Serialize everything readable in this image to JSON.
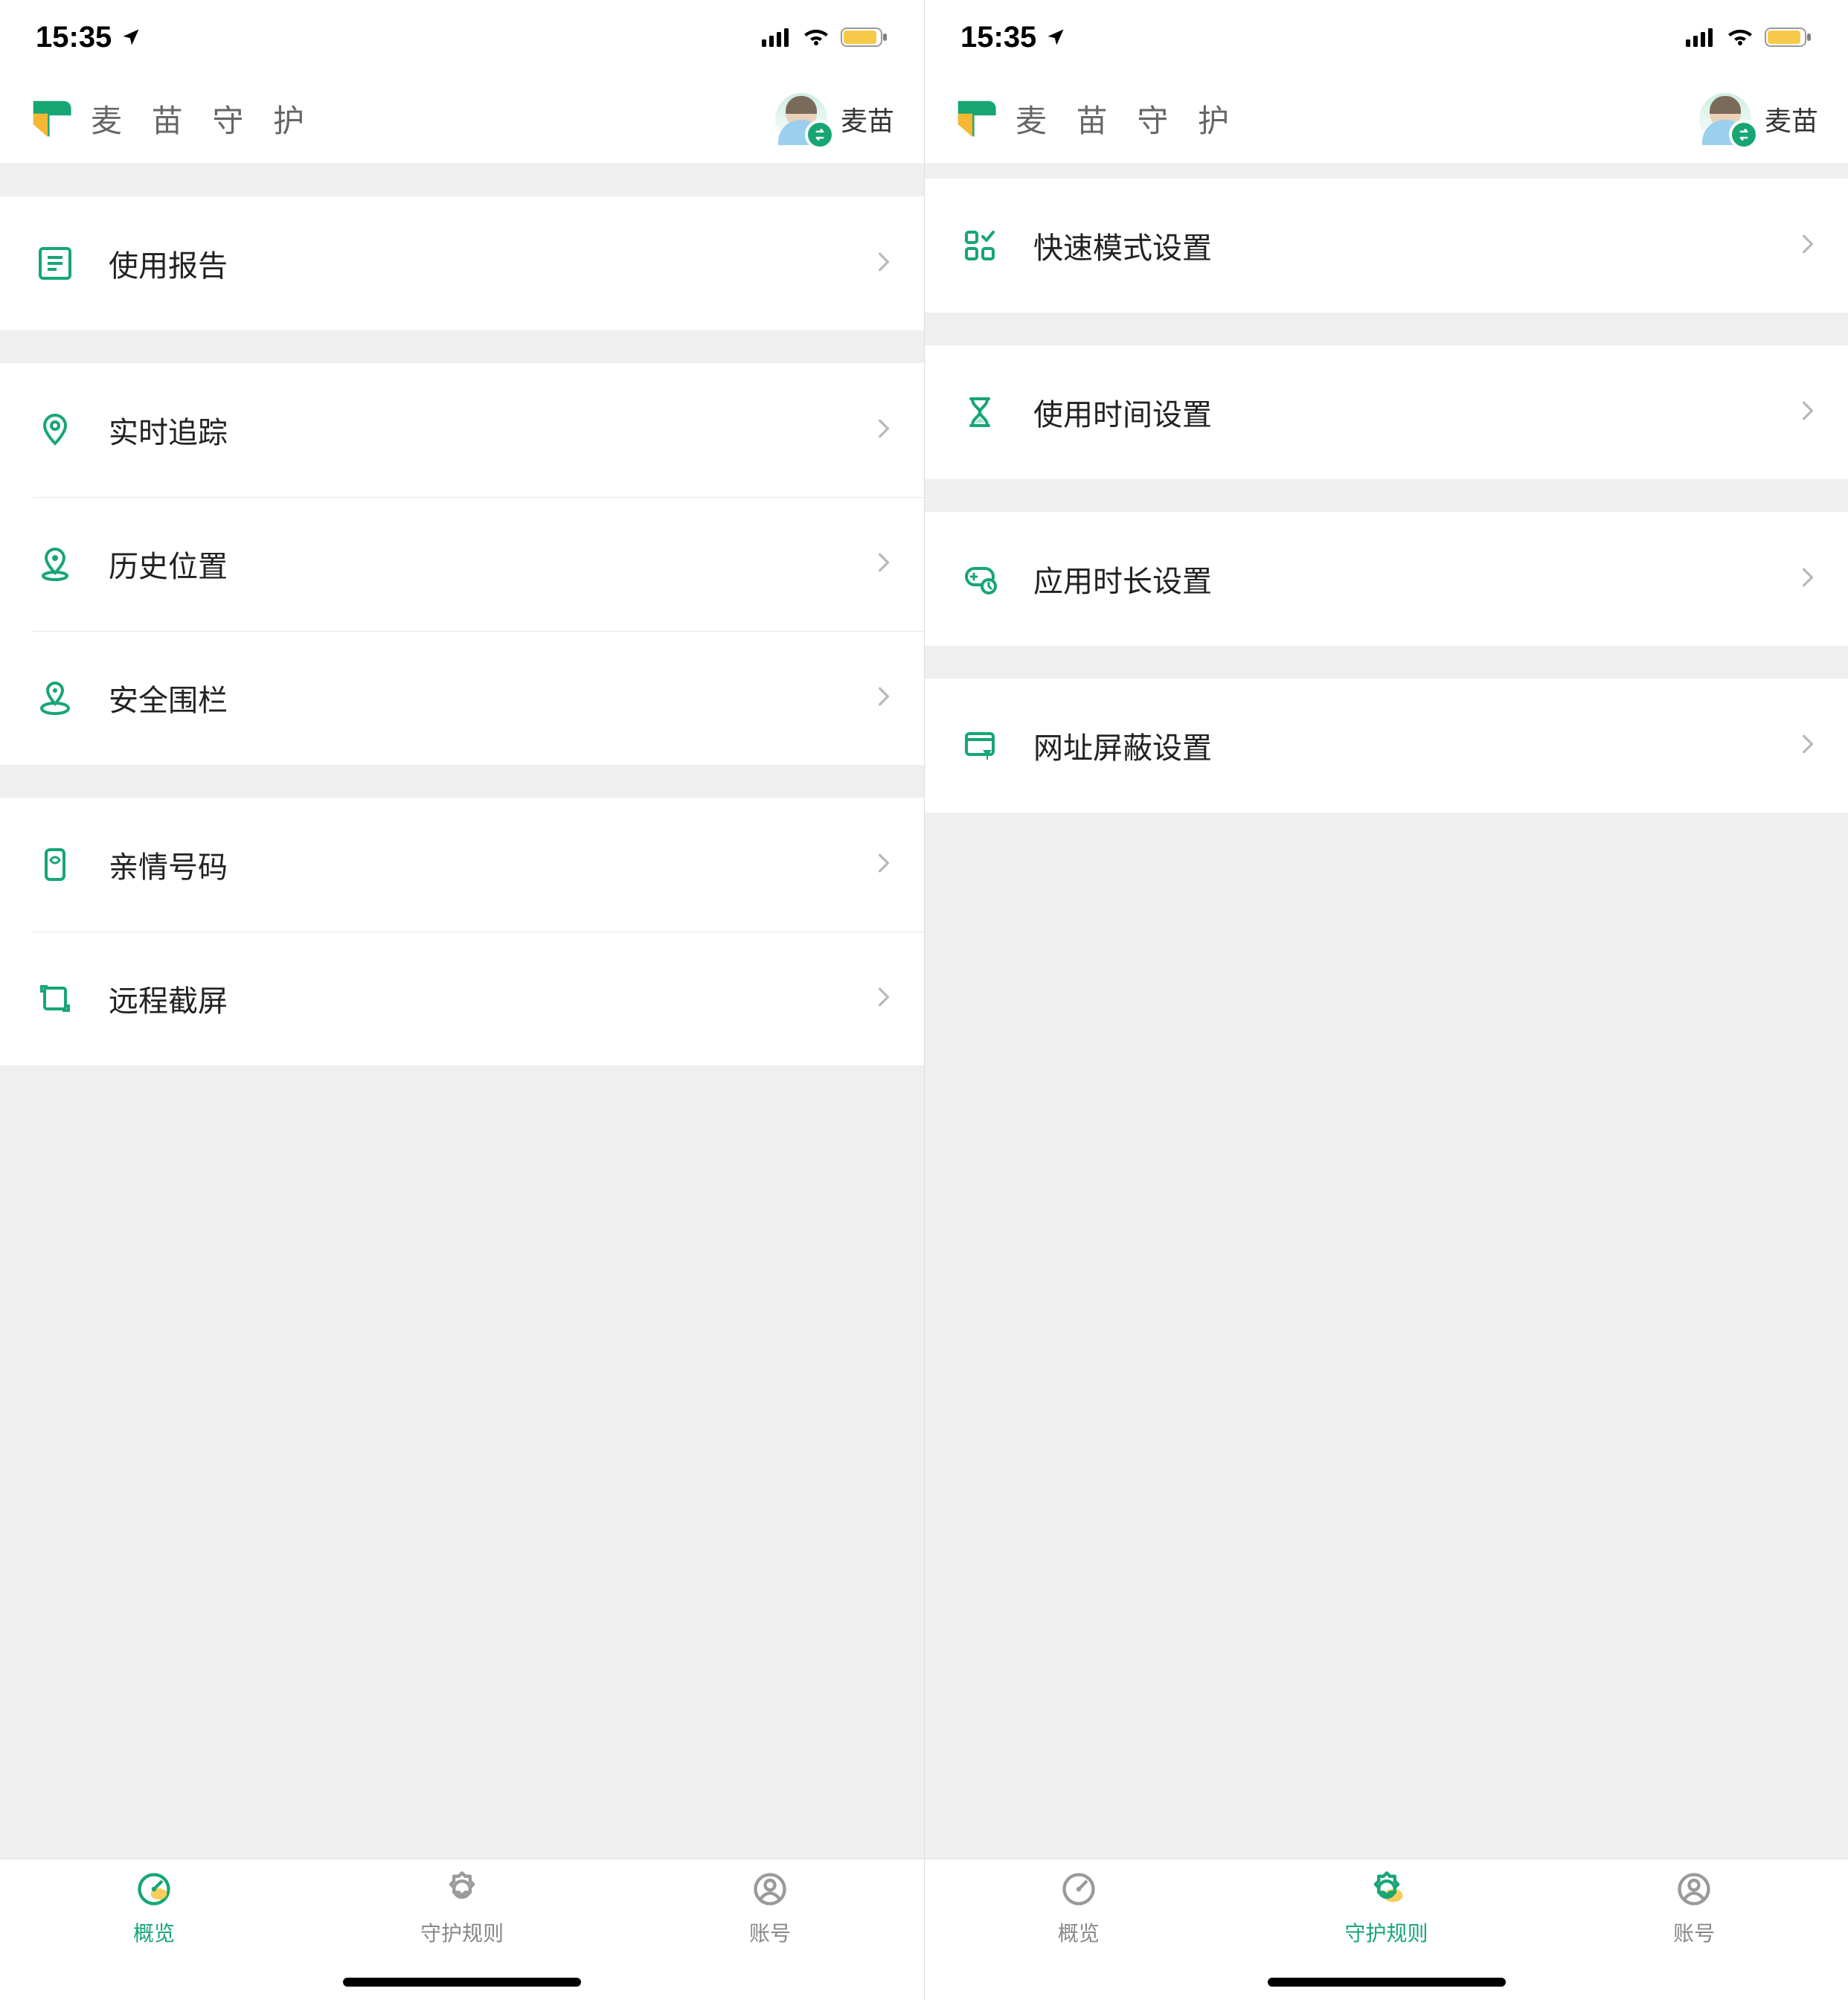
{
  "status": {
    "time": "15:35"
  },
  "header": {
    "app_title": "麦 苗 守 护",
    "profile_name": "麦苗"
  },
  "colors": {
    "accent": "#17a673",
    "accent2": "#f7b733"
  },
  "left": {
    "groups": [
      {
        "rows": [
          {
            "icon": "report",
            "label": "使用报告"
          }
        ]
      },
      {
        "rows": [
          {
            "icon": "pin",
            "label": "实时追踪"
          },
          {
            "icon": "pin-history",
            "label": "历史位置"
          },
          {
            "icon": "geofence",
            "label": "安全围栏"
          }
        ]
      },
      {
        "rows": [
          {
            "icon": "family-phone",
            "label": "亲情号码"
          },
          {
            "icon": "screenshot",
            "label": "远程截屏"
          }
        ]
      }
    ],
    "tabs": [
      {
        "icon": "gauge",
        "label": "概览",
        "active": true
      },
      {
        "icon": "gear-shield",
        "label": "守护规则",
        "active": false
      },
      {
        "icon": "account",
        "label": "账号",
        "active": false
      }
    ]
  },
  "right": {
    "groups": [
      {
        "rows": [
          {
            "icon": "grid-check",
            "label": "快速模式设置"
          }
        ]
      },
      {
        "rows": [
          {
            "icon": "hourglass",
            "label": "使用时间设置"
          }
        ]
      },
      {
        "rows": [
          {
            "icon": "game-time",
            "label": "应用时长设置"
          }
        ]
      },
      {
        "rows": [
          {
            "icon": "web-filter",
            "label": "网址屏蔽设置"
          }
        ]
      }
    ],
    "tabs": [
      {
        "icon": "gauge",
        "label": "概览",
        "active": false
      },
      {
        "icon": "gear-shield",
        "label": "守护规则",
        "active": true
      },
      {
        "icon": "account",
        "label": "账号",
        "active": false
      }
    ]
  }
}
